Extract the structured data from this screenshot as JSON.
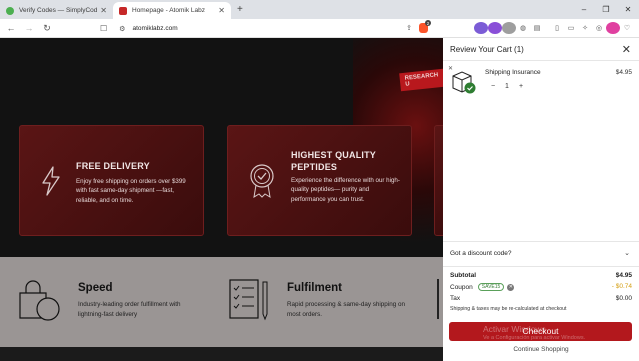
{
  "tabs": [
    {
      "title": "Verify Codes — SimplyCodes",
      "favicon_color": "#4caf50"
    },
    {
      "title": "Homepage - Atomik Labz",
      "favicon_color": "#c62828"
    }
  ],
  "new_tab_icon": "plus-icon",
  "window_controls": {
    "minimize": "–",
    "maximize": "❐",
    "close": "✕"
  },
  "toolbar": {
    "url": "atomiklabz.com",
    "extension_badge": "2"
  },
  "page": {
    "research_tag": "RESEARCH U",
    "cards": [
      {
        "title": "FREE DELIVERY",
        "text": "Enjoy free shipping on orders over $399 with fast same-day shipment —fast, reliable, and on time.",
        "icon": "lightning-icon"
      },
      {
        "title": "HIGHEST QUALITY PEPTIDES",
        "text": "Experience the difference with our high-quality peptides— purity and performance you can trust.",
        "icon": "quality-badge-icon"
      }
    ],
    "features": [
      {
        "title": "Speed",
        "text": "Industry-leading order fulfillment with lightning-fast delivery",
        "icon": "shopping-bag-clock-icon"
      },
      {
        "title": "Fulfilment",
        "text": "Rapid processing & same-day shipping on most orders.",
        "icon": "checklist-pencil-icon"
      }
    ]
  },
  "cart": {
    "title": "Review Your Cart (1)",
    "items": [
      {
        "name": "Shipping Insurance",
        "price": "$4.95",
        "quantity": "1"
      }
    ],
    "discount_label": "Got a discount code?",
    "subtotal_label": "Subtotal",
    "subtotal_value": "$4.95",
    "coupon_label": "Coupon",
    "coupon_code": "SAVE15",
    "coupon_value": "- $0.74",
    "tax_label": "Tax",
    "tax_value": "$0.00",
    "note": "Shipping & taxes may be re-calculated at checkout",
    "checkout_label": "Checkout",
    "continue_label": "Continue Shopping",
    "watermark_1": "Activar Windows",
    "watermark_2": "Ve a Configuración para activar Windows.",
    "accent_color": "#b3181d",
    "coupon_color": "#3a7f3a"
  }
}
